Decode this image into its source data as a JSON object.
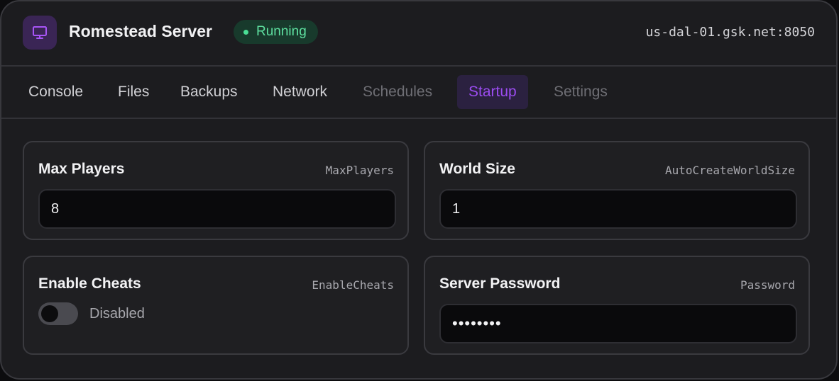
{
  "header": {
    "icon": "monitor-icon",
    "title": "Romestead Server",
    "status": "Running",
    "status_color": "#4ade95",
    "address": "us-dal-01.gsk.net:8050"
  },
  "tabs": [
    {
      "label": "Console",
      "state": "normal"
    },
    {
      "label": "Files",
      "state": "normal"
    },
    {
      "label": "Backups",
      "state": "normal"
    },
    {
      "label": "Network",
      "state": "normal"
    },
    {
      "label": "Schedules",
      "state": "muted"
    },
    {
      "label": "Startup",
      "state": "active"
    },
    {
      "label": "Settings",
      "state": "muted"
    }
  ],
  "accent_color": "#9b4cf0",
  "variables": {
    "max_players": {
      "label": "Max Players",
      "key": "MaxPlayers",
      "value": "8"
    },
    "world_size": {
      "label": "World Size",
      "key": "AutoCreateWorldSize",
      "value": "1"
    },
    "enable_cheats": {
      "label": "Enable Cheats",
      "key": "EnableCheats",
      "enabled": false,
      "state_text": "Disabled"
    },
    "server_password": {
      "label": "Server Password",
      "key": "Password",
      "value": "••••••••"
    }
  }
}
